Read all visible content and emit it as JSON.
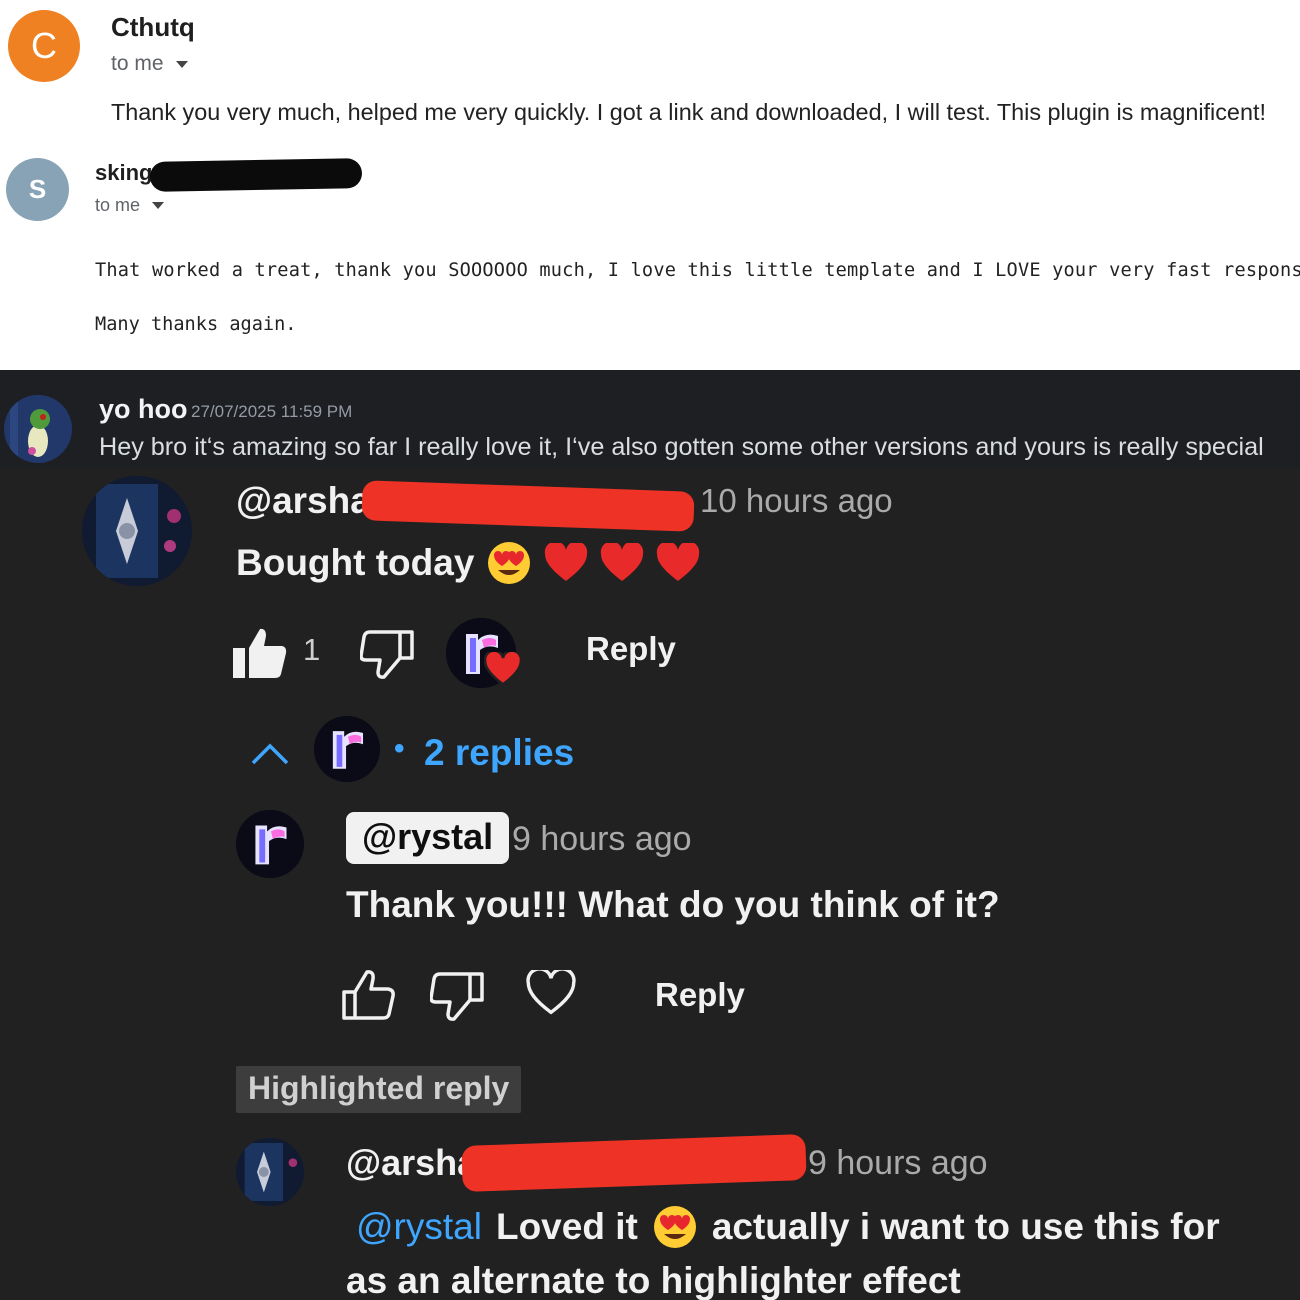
{
  "email1": {
    "avatar_letter": "C",
    "sender": "Cthutq",
    "to_me": "to me",
    "body": "Thank you very much, helped me very quickly. I got a link and downloaded, I will test. This plugin is magnificent!"
  },
  "email2": {
    "avatar_letter": "S",
    "sender": "sking",
    "to_me": "to me",
    "body_line1": "That worked a treat, thank you SOOOOOO much, I love this little template and I LOVE your very fast response.",
    "body_line2": "Many thanks again."
  },
  "discord": {
    "username": "yo hoo",
    "timestamp": "27/07/2025 11:59 PM",
    "message": "Hey bro it‘s amazing so far I really love it, I‘ve also gotten some other versions and yours is really special"
  },
  "youtube": {
    "comment": {
      "handle": "@arshad",
      "time": "10 hours ago",
      "text": "Bought today",
      "like_count": "1",
      "reply_label": "Reply"
    },
    "replies_toggle": {
      "separator": "•",
      "label": "2 replies"
    },
    "reply1": {
      "handle": "@rystal",
      "time": "9 hours ago",
      "text": "Thank you!!! What do you think of it?",
      "reply_label": "Reply"
    },
    "highlighted_label": "Highlighted reply",
    "reply2": {
      "handle": "@arsha",
      "time": "9 hours ago",
      "mention": "@rystal",
      "text_a": "Loved it",
      "text_b": "actually i want to use this for",
      "text_line2": "as an alternate to highlighter effect"
    }
  },
  "colors": {
    "orange_avatar": "#ef8123",
    "grey_avatar": "#89a3b6",
    "discord_bg": "#1e1f22",
    "youtube_bg": "#212121",
    "link_blue": "#3ea6ff",
    "redaction_red": "#ee3326"
  }
}
